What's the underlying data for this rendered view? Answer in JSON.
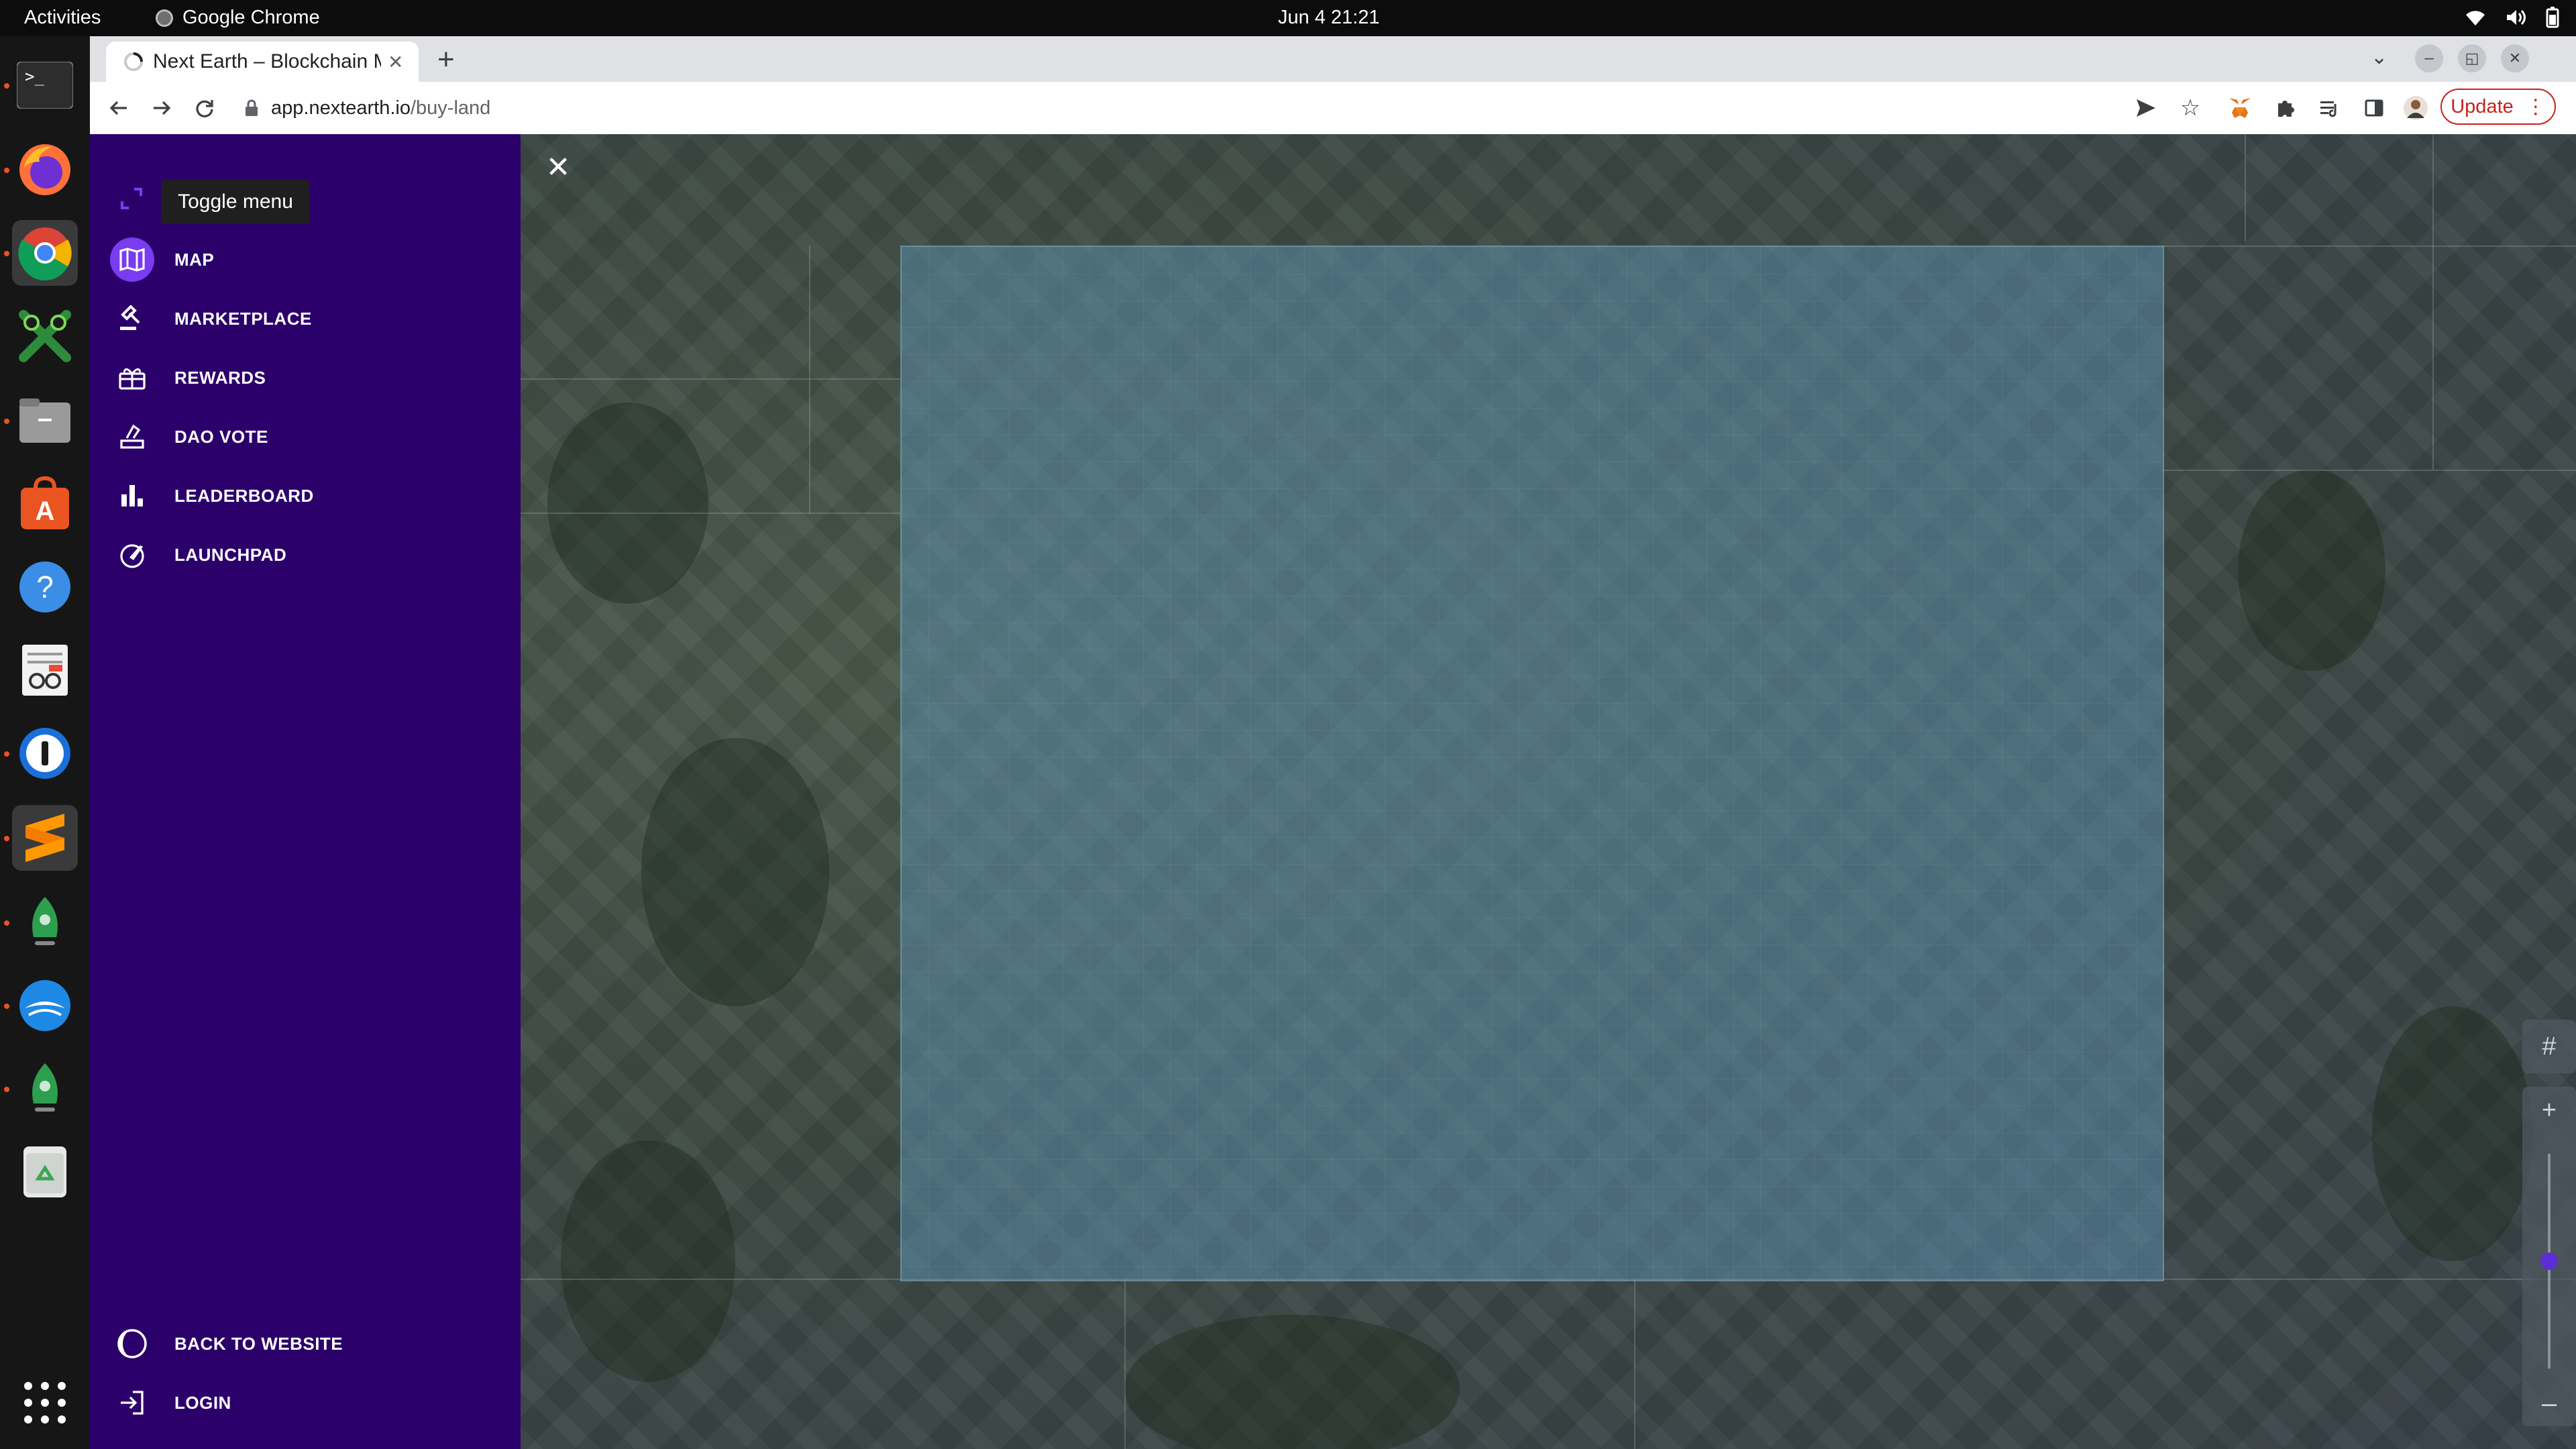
{
  "topbar": {
    "activities": "Activities",
    "app_name": "Google Chrome",
    "clock": "Jun 4  21:21"
  },
  "dock": {
    "items": [
      "terminal-icon",
      "firefox-icon",
      "chrome-icon",
      "inkscape-icon",
      "files-icon",
      "app-center-icon",
      "help-icon",
      "text-editor-icon",
      "password-manager-icon",
      "sublime-icon",
      "rocket-icon",
      "openoffice-icon",
      "rocket-icon-2",
      "trash-icon"
    ],
    "apps_grid": "show-apps-icon"
  },
  "browser": {
    "tab_title": "Next Earth – Blockchain M",
    "new_tab": "+",
    "url_host": "app.nextearth.io",
    "url_path": "/buy-land",
    "update_label": "Update",
    "window_minimize": "–",
    "window_restore": "◱",
    "window_close": "✕"
  },
  "sidebar": {
    "tooltip": "Toggle menu",
    "items": [
      {
        "label": "MAP",
        "icon": "map-icon",
        "active": true
      },
      {
        "label": "MARKETPLACE",
        "icon": "gavel-icon",
        "active": false
      },
      {
        "label": "REWARDS",
        "icon": "gift-icon",
        "active": false
      },
      {
        "label": "DAO VOTE",
        "icon": "vote-icon",
        "active": false
      },
      {
        "label": "LEADERBOARD",
        "icon": "bar-chart-icon",
        "active": false
      },
      {
        "label": "LAUNCHPAD",
        "icon": "rocket-launch-icon",
        "active": false
      }
    ],
    "bottom": [
      {
        "label": "BACK TO WEBSITE",
        "icon": "earth-logo-icon"
      },
      {
        "label": "LOGIN",
        "icon": "login-icon"
      }
    ]
  },
  "map": {
    "close": "✕",
    "grid_toggle": "#",
    "zoom_in": "+",
    "zoom_out": "–",
    "zoom_level": 0.5
  },
  "colors": {
    "sidebar_bg": "#2c006b",
    "accent": "#7a3cf0",
    "update": "#c5221f"
  }
}
